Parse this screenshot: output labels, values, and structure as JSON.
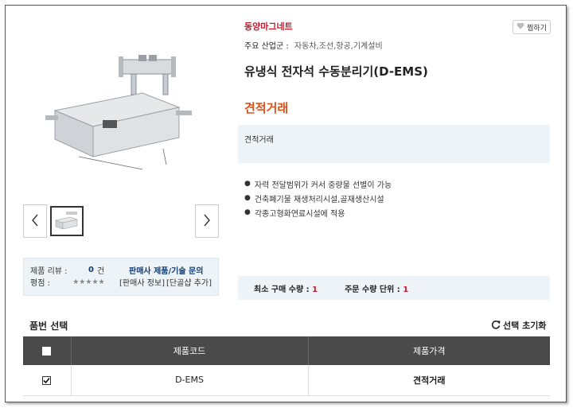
{
  "brand": "동양마그네트",
  "like_button": "찜하기",
  "industry": {
    "label": "주요 산업군 :",
    "value": "자동차,조선,항공,기계설비"
  },
  "product_title": "유냉식 전자석 수동분리기(D-EMS)",
  "price_title": "견적거래",
  "price_note": "견적거래",
  "features": [
    "자력 전달범위가 커서 중량물 선별이 가능",
    "건축폐기물 재생처리시설,골재생산시설",
    "각종고형화연료시설에 적용"
  ],
  "review": {
    "review_label": "제품 리뷰 :",
    "review_count": "0",
    "review_unit": "건",
    "inquiry_link": "판매사 제품/기술 문의",
    "rating_label": "평점 :",
    "stars": "★★★★★",
    "seller_info": "[판매사 정보]",
    "add_rating": "[단골샵 추가]"
  },
  "order": {
    "min_label": "최소 구매 수량 :",
    "min_value": "1",
    "unit_label": "주문 수량 단위 :",
    "unit_value": "1"
  },
  "options": {
    "title": "품번 선택",
    "reset": "선택 초기화",
    "headers": [
      "제품코드",
      "제품가격"
    ],
    "rows": [
      {
        "code": "D-EMS",
        "price": "견적거래",
        "checked": true
      }
    ]
  },
  "colors": {
    "brand_red": "#c41a2e",
    "price_orange": "#d9531e",
    "link_navy": "#123d73",
    "panel_bg": "#eef3f8",
    "table_header": "#4a4a4a"
  },
  "icons": [
    "chevron-left-icon",
    "chevron-right-icon",
    "heart-icon",
    "refresh-icon",
    "checkbox-icon"
  ]
}
